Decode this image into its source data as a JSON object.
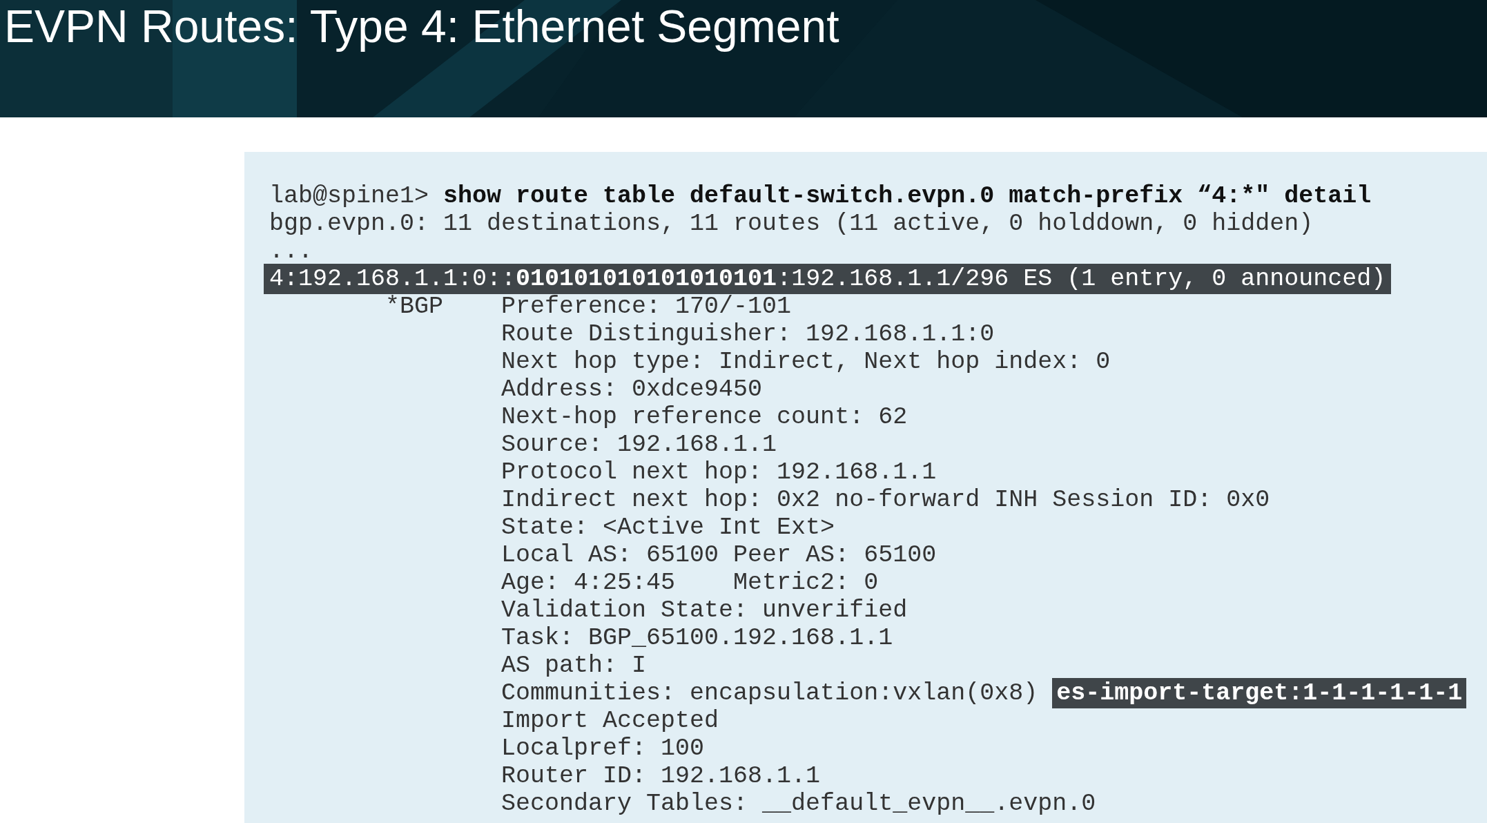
{
  "header": {
    "title": "EVPN Routes: Type 4: Ethernet Segment"
  },
  "terminal": {
    "lines": [
      {
        "kind": "command",
        "prompt": "lab@spine1>",
        "command": "show route table default-switch.evpn.0 match-prefix “4:*\" detail"
      },
      {
        "kind": "plain",
        "text": "bgp.evpn.0: 11 destinations, 11 routes (11 active, 0 holddown, 0 hidden)"
      },
      {
        "kind": "plain",
        "text": "..."
      },
      {
        "kind": "highlight",
        "text": "4:192.168.1.1:0::**010101010101010101**:192.168.1.1/296 ES (1 entry, 0 announced)"
      },
      {
        "kind": "entry",
        "tag": "*BGP",
        "text": "Preference: 170/-101"
      },
      {
        "kind": "detail",
        "text": "Route Distinguisher: 192.168.1.1:0"
      },
      {
        "kind": "detail",
        "text": "Next hop type: Indirect, Next hop index: 0"
      },
      {
        "kind": "detail",
        "text": "Address: 0xdce9450"
      },
      {
        "kind": "detail",
        "text": "Next-hop reference count: 62"
      },
      {
        "kind": "detail",
        "text": "Source: 192.168.1.1"
      },
      {
        "kind": "detail",
        "text": "Protocol next hop: 192.168.1.1"
      },
      {
        "kind": "detail",
        "text": "Indirect next hop: 0x2 no-forward INH Session ID: 0x0"
      },
      {
        "kind": "detail",
        "text": "State: <Active Int Ext>"
      },
      {
        "kind": "detail",
        "text": "Local AS: 65100 Peer AS: 65100"
      },
      {
        "kind": "detail",
        "text": "Age: 4:25:45    Metric2: 0"
      },
      {
        "kind": "detail",
        "text": "Validation State: unverified"
      },
      {
        "kind": "detail",
        "text": "Task: BGP_65100.192.168.1.1"
      },
      {
        "kind": "detail",
        "text": "AS path: I"
      },
      {
        "kind": "detail",
        "text": "Communities: encapsulation:vxlan(0x8)",
        "highlight": "es-import-target:1-1-1-1-1-1"
      },
      {
        "kind": "detail",
        "text": "Import Accepted"
      },
      {
        "kind": "detail",
        "text": "Localpref: 100"
      },
      {
        "kind": "detail",
        "text": "Router ID: 192.168.1.1"
      },
      {
        "kind": "detail",
        "text": "Secondary Tables: __default_evpn__.evpn.0"
      }
    ]
  }
}
